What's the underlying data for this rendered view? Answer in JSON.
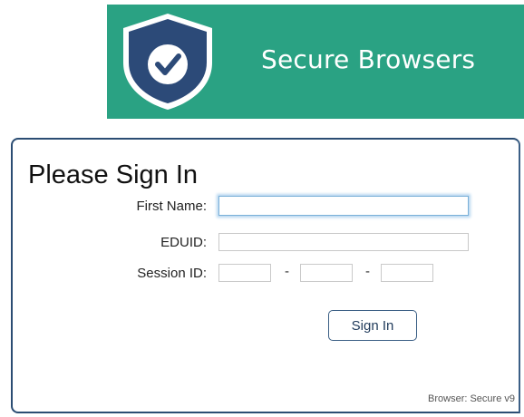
{
  "banner": {
    "brand_text": "Secure Browsers",
    "logo_icon": "shield-check-icon",
    "background_color": "#2aa283"
  },
  "signin": {
    "title": "Please Sign In",
    "first_name_label": "First Name:",
    "first_name_value": "",
    "eduid_label": "EDUID:",
    "eduid_value": "",
    "session_id_label": "Session ID:",
    "session_separator": "-",
    "session_part1": "",
    "session_part2": "",
    "session_part3": "",
    "button_label": "Sign In",
    "browser_version": "Browser: Secure v9"
  }
}
